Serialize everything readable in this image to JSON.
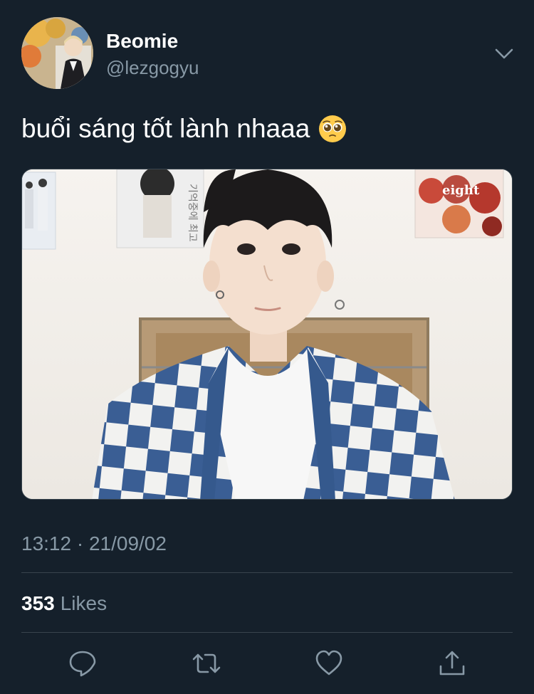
{
  "user": {
    "display_name": "Beomie",
    "handle": "@lezgogyu"
  },
  "tweet": {
    "text": "buổi sáng tốt lành nhaaa",
    "emoji": "pleading-face-emoji",
    "timestamp": "13:12 · 21/09/02"
  },
  "media": {
    "poster_text_eight": "eight",
    "poster_text_korean": "기억중에 최고"
  },
  "stats": {
    "likes_count": "353",
    "likes_label": "Likes"
  },
  "actions": [
    "reply-icon",
    "retweet-icon",
    "like-icon",
    "share-icon"
  ],
  "colors": {
    "background": "#15202b",
    "secondary_text": "#8899a6",
    "divider": "#38444d",
    "text": "#ffffff"
  }
}
